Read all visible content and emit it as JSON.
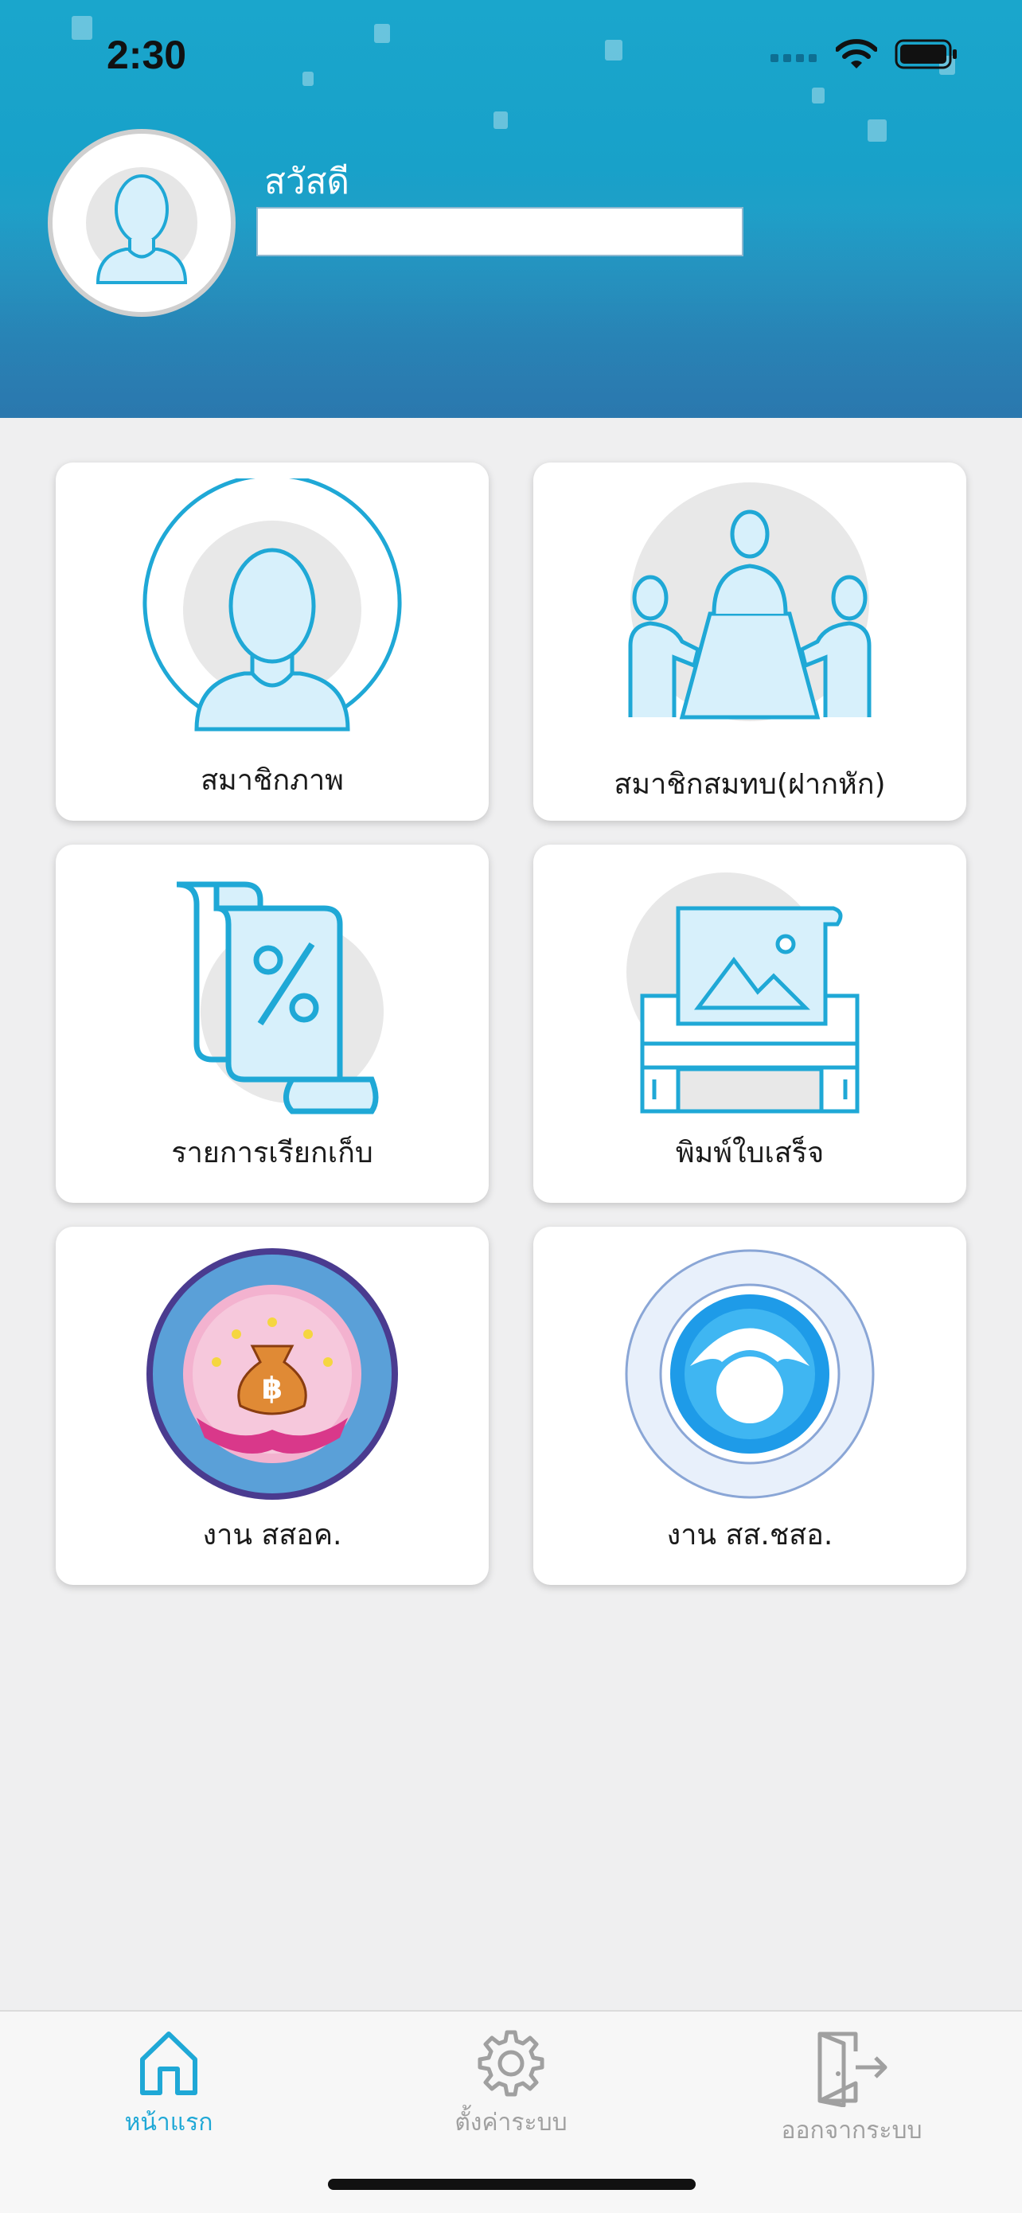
{
  "status_bar": {
    "time": "2:30"
  },
  "header": {
    "greeting": "สวัสดี",
    "user_name": ""
  },
  "menu": [
    {
      "label": "สมาชิกภาพ",
      "icon": "member-profile-icon"
    },
    {
      "label": "สมาชิกสมทบ(ฝากหัก)",
      "icon": "associate-meeting-icon"
    },
    {
      "label": "รายการเรียกเก็บ",
      "icon": "billing-list-icon"
    },
    {
      "label": "พิมพ์ใบเสร็จ",
      "icon": "print-receipt-icon"
    },
    {
      "label": "งาน สสอค.",
      "icon": "ssok-logo"
    },
    {
      "label": "งาน สส.ชสอ.",
      "icon": "sschso-logo"
    }
  ],
  "tabs": [
    {
      "label": "หน้าแรก",
      "icon": "home-icon",
      "active": true
    },
    {
      "label": "ตั้งค่าระบบ",
      "icon": "gear-icon",
      "active": false
    },
    {
      "label": "ออกจากระบบ",
      "icon": "logout-icon",
      "active": false
    }
  ],
  "colors": {
    "accent": "#1fa8d6",
    "inactive": "#a0a0a0",
    "header": "#1aa6cc"
  }
}
